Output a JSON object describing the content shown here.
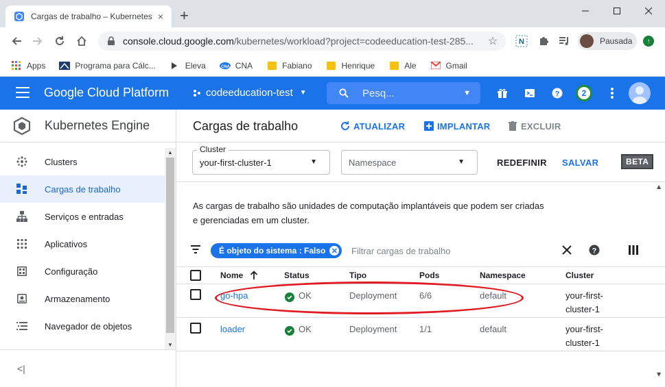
{
  "browser": {
    "tab_title": "Cargas de trabalho – Kubernetes",
    "tab_close": "×",
    "new_tab": "+",
    "url_host": "console.cloud.google.com",
    "url_path": "/kubernetes/workload?project=codeeducation-test-285...",
    "profile_label": "Pausada",
    "bookmarks": [
      {
        "label": "Apps",
        "icon": "apps-grid-icon"
      },
      {
        "label": "Programa para Cálc...",
        "icon": "calc-icon"
      },
      {
        "label": "Eleva",
        "icon": "eleva-icon"
      },
      {
        "label": "CNA",
        "icon": "cna-icon"
      },
      {
        "label": "Fabiano",
        "icon": "folder-icon"
      },
      {
        "label": "Henrique",
        "icon": "folder-icon"
      },
      {
        "label": "Ale",
        "icon": "folder-icon"
      },
      {
        "label": "Gmail",
        "icon": "gmail-icon"
      }
    ]
  },
  "gcp": {
    "platform_title": "Google Cloud Platform",
    "project_name": "codeeducation-test",
    "search_placeholder": "Pesq...",
    "notifications_count": "2"
  },
  "sidebar": {
    "product_title": "Kubernetes Engine",
    "items": [
      {
        "label": "Clusters",
        "icon": "clusters-icon",
        "active": false
      },
      {
        "label": "Cargas de trabalho",
        "icon": "workloads-icon",
        "active": true
      },
      {
        "label": "Serviços e entradas",
        "icon": "services-icon",
        "active": false
      },
      {
        "label": "Aplicativos",
        "icon": "apps-icon",
        "active": false
      },
      {
        "label": "Configuração",
        "icon": "config-icon",
        "active": false
      },
      {
        "label": "Armazenamento",
        "icon": "storage-icon",
        "active": false
      },
      {
        "label": "Navegador de objetos",
        "icon": "object-browser-icon",
        "active": false
      }
    ],
    "collapse_glyph": "<|"
  },
  "main": {
    "title": "Cargas de trabalho",
    "actions": {
      "refresh": "ATUALIZAR",
      "deploy": "IMPLANTAR",
      "delete": "EXCLUIR"
    },
    "filters": {
      "cluster_legend": "Cluster",
      "cluster_value": "your-first-cluster-1",
      "namespace_placeholder": "Namespace",
      "reset": "REDEFINIR",
      "save": "SALVAR",
      "beta": "BETA"
    },
    "description_line1": "As cargas de trabalho são unidades de computação implantáveis que podem ser criadas",
    "description_line2": "e gerenciadas em um cluster.",
    "filter_chip": "É objeto do sistema : Falso",
    "filter_placeholder": "Filtrar cargas de trabalho",
    "table": {
      "headers": {
        "name": "Nome",
        "status": "Status",
        "type": "Tipo",
        "pods": "Pods",
        "namespace": "Namespace",
        "cluster": "Cluster"
      },
      "rows": [
        {
          "name": "go-hpa",
          "status": "OK",
          "type": "Deployment",
          "pods": "6/6",
          "namespace": "default",
          "cluster_line1": "your-first-",
          "cluster_line2": "cluster-1"
        },
        {
          "name": "loader",
          "status": "OK",
          "type": "Deployment",
          "pods": "1/1",
          "namespace": "default",
          "cluster_line1": "your-first-",
          "cluster_line2": "cluster-1"
        }
      ]
    }
  },
  "colors": {
    "gcp_blue": "#1a73e8",
    "status_ok": "#188038",
    "annotation_red": "#e01b24"
  }
}
